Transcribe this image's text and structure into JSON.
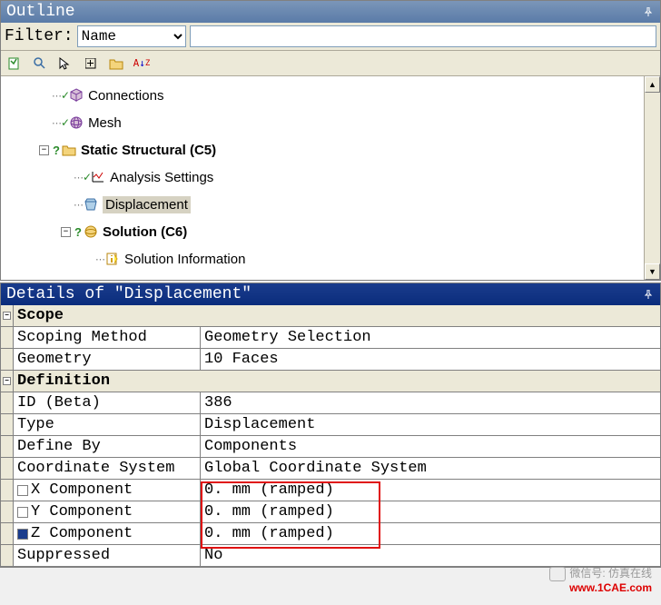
{
  "outline": {
    "title": "Outline",
    "filter_label": "Filter:",
    "filter_selected": "Name",
    "tree": [
      {
        "indent": 52,
        "check": true,
        "icon": "cube",
        "label": "Connections"
      },
      {
        "indent": 52,
        "check": true,
        "icon": "sphere",
        "label": "Mesh"
      },
      {
        "indent": 38,
        "expander": "-",
        "q": true,
        "icon": "folder",
        "label": "Static Structural (C5)",
        "bold": true
      },
      {
        "indent": 76,
        "check": true,
        "icon": "chart",
        "label": "Analysis Settings"
      },
      {
        "indent": 76,
        "icon": "box",
        "label": "Displacement",
        "selected": true
      },
      {
        "indent": 62,
        "expander": "-",
        "q": true,
        "icon": "sphere-y",
        "label": "Solution (C6)",
        "bold": true
      },
      {
        "indent": 100,
        "icon": "info",
        "label": "Solution Information"
      }
    ]
  },
  "details": {
    "title": "Details of \"Displacement\"",
    "groups": [
      {
        "name": "Scope",
        "rows": [
          {
            "label": "Scoping Method",
            "value": "Geometry Selection"
          },
          {
            "label": "Geometry",
            "value": "10 Faces"
          }
        ]
      },
      {
        "name": "Definition",
        "rows": [
          {
            "label": "ID (Beta)",
            "value": "386"
          },
          {
            "label": "Type",
            "value": "Displacement"
          },
          {
            "label": "Define By",
            "value": "Components"
          },
          {
            "label": "Coordinate System",
            "value": "Global Coordinate System"
          },
          {
            "label": "X Component",
            "value": "0. mm (ramped)",
            "chk": "empty"
          },
          {
            "label": "Y Component",
            "value": "0. mm (ramped)",
            "chk": "empty"
          },
          {
            "label": "Z Component",
            "value": "0. mm (ramped)",
            "chk": "filled"
          },
          {
            "label": "Suppressed",
            "value": "No"
          }
        ]
      }
    ]
  },
  "watermark": {
    "line1": "微信号: 仿真在线",
    "line2": "www.1CAE.com"
  }
}
